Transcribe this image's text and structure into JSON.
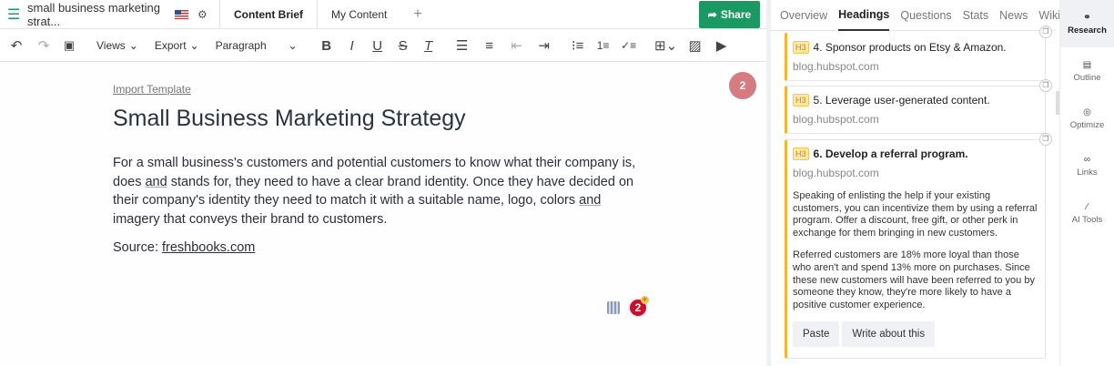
{
  "header": {
    "doc_title": "small business marketing strat...",
    "tabs": [
      "Content Brief",
      "My Content"
    ],
    "share_label": "Share"
  },
  "toolbar": {
    "views": "Views",
    "export": "Export",
    "paragraph": "Paragraph"
  },
  "editor": {
    "import_template": "Import Template",
    "title": "Small Business Marketing Strategy",
    "para_parts": [
      "For a small business's customers and potential customers to know what their company is, does ",
      "and",
      " stands for, they need to have a clear brand identity. Once they have decided on their company's identity they need to match it with a suitable name, logo, colors ",
      "and",
      " imagery that conveys their brand to customers."
    ],
    "source_label": "Source: ",
    "source_link": "freshbooks.com",
    "badge_count": "2",
    "notif_count": "2"
  },
  "research": {
    "tabs": [
      "Overview",
      "Headings",
      "Questions",
      "Stats",
      "News",
      "Wiki"
    ],
    "cards": [
      {
        "tag": "H3",
        "title": "4. Sponsor products on Etsy & Amazon.",
        "source": "blog.hubspot.com"
      },
      {
        "tag": "H3",
        "title": "5. Leverage user-generated content.",
        "source": "blog.hubspot.com"
      },
      {
        "tag": "H3",
        "title": "6. Develop a referral program.",
        "source": "blog.hubspot.com",
        "paragraphs": [
          "Speaking of enlisting the help if your existing customers, you can incentivize them by using a referral program. Offer a discount, free gift, or other perk in exchange for them bringing in new customers.",
          "Referred customers are 18% more loyal than those who aren't and spend 13% more on purchases. Since these new customers will have been referred to you by someone they know, they're more likely to have a positive customer experience."
        ],
        "paste": "Paste",
        "write": "Write about this"
      }
    ]
  },
  "sidebar": {
    "items": [
      "Research",
      "Outline",
      "Optimize",
      "Links",
      "AI Tools"
    ]
  },
  "colors": {
    "accent": "#1a9a62",
    "card_border": "#f4b63a"
  }
}
